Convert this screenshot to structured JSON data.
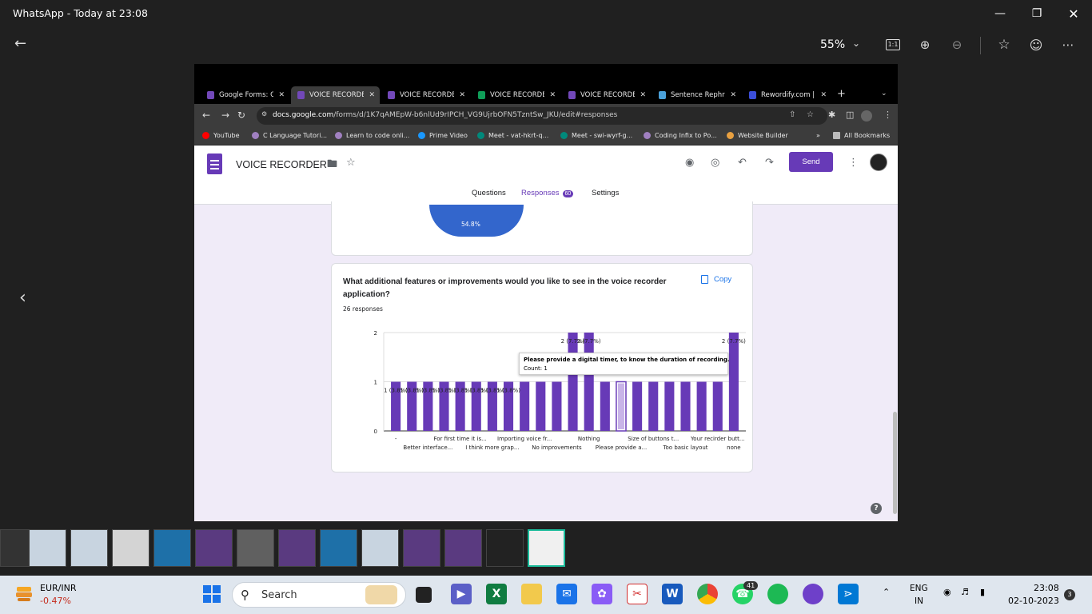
{
  "viewer": {
    "title": "WhatsApp - Today at 23:08",
    "zoom": "55%",
    "ratio_label": "1:1"
  },
  "browser": {
    "tabs": [
      {
        "label": "Google Forms: O",
        "icon_color": "#7248b9",
        "active": false
      },
      {
        "label": "VOICE RECORDE",
        "icon_color": "#7248b9",
        "active": true
      },
      {
        "label": "VOICE RECORDE",
        "icon_color": "#7248b9",
        "active": false
      },
      {
        "label": "VOICE RECORDE",
        "icon_color": "#0f9d58",
        "active": false
      },
      {
        "label": "VOICE RECORDE",
        "icon_color": "#7248b9",
        "active": false
      },
      {
        "label": "Sentence Rephra",
        "icon_color": "#4aa0d8",
        "active": false
      },
      {
        "label": "Rewordify.com |",
        "icon_color": "#3b4ed8",
        "active": false
      }
    ],
    "url_host": "docs.google.com",
    "url_path": "/forms/d/1K7qAMEpW-b6nlUd9rIPCH_VG9UjrbOFN5TzntSw_JKU/edit#responses",
    "bookmarks": [
      {
        "label": "YouTube",
        "icon_color": "#ff0000"
      },
      {
        "label": "C Language Tutori...",
        "icon_color": "#a080c0"
      },
      {
        "label": "Learn to code onli...",
        "icon_color": "#a080c0"
      },
      {
        "label": "Prime Video",
        "icon_color": "#1a98ff"
      },
      {
        "label": "Meet - vat-hkrt-q...",
        "icon_color": "#00897b"
      },
      {
        "label": "Meet - swi-wyrf-g...",
        "icon_color": "#00897b"
      },
      {
        "label": "Coding Infix to Po...",
        "icon_color": "#a080c0"
      },
      {
        "label": "Website Builder",
        "icon_color": "#e8a040"
      }
    ],
    "bookmarks_more": "»",
    "all_bookmarks": "All Bookmarks"
  },
  "form": {
    "title": "VOICE RECORDER",
    "send_label": "Send",
    "tabs": {
      "questions": "Questions",
      "responses": "Responses",
      "responses_count": "60",
      "settings": "Settings"
    },
    "pie_label": "54.8%",
    "question": {
      "title": "What additional features or improvements would you like to see in the voice recorder application?",
      "responses": "26 responses",
      "copy_label": "Copy"
    },
    "tooltip": {
      "title": "Please provide a digital timer, to know the duration of recording.",
      "count": "Count: 1"
    },
    "help": "?"
  },
  "chart_data": {
    "type": "bar",
    "values": [
      1,
      1,
      1,
      1,
      1,
      1,
      1,
      1,
      1,
      1,
      1,
      2,
      2,
      1,
      1,
      1,
      1,
      1,
      1,
      1,
      1,
      2
    ],
    "highlighted_index": 14,
    "ylim": [
      0,
      2
    ],
    "yticks": [
      "0",
      "1",
      "2"
    ],
    "color": "#673ab7",
    "bar_labels": [
      {
        "index": 0,
        "text": "1 (3.8%)"
      },
      {
        "index": 1,
        "text": "1 (3.8%)"
      },
      {
        "index": 2,
        "text": "1 (3.8%)"
      },
      {
        "index": 3,
        "text": "1 (3.8%)"
      },
      {
        "index": 4,
        "text": "1 (3.8%)"
      },
      {
        "index": 5,
        "text": "1 (3.8%)"
      },
      {
        "index": 6,
        "text": "1 (3.8%)"
      },
      {
        "index": 7,
        "text": "1 (3.8%)"
      },
      {
        "index": 11,
        "text": "2 (7.7%)"
      },
      {
        "index": 12,
        "text": "2 (7.7%)"
      },
      {
        "index": 21,
        "text": "2 (7.7%)"
      }
    ],
    "x_labels_upper": [
      {
        "index": 0,
        "text": "-"
      },
      {
        "index": 4,
        "text": "For first time it is..."
      },
      {
        "index": 8,
        "text": "Importing voice fr..."
      },
      {
        "index": 12,
        "text": "Nothing"
      },
      {
        "index": 16,
        "text": "Size of buttons t..."
      },
      {
        "index": 20,
        "text": "Your recirder butt..."
      }
    ],
    "x_labels_lower": [
      {
        "index": 2,
        "text": "Better interface..."
      },
      {
        "index": 6,
        "text": "I think more grap..."
      },
      {
        "index": 10,
        "text": "No improvements"
      },
      {
        "index": 14,
        "text": "Please provide a..."
      },
      {
        "index": 18,
        "text": "Too basic layout"
      },
      {
        "index": 22,
        "text": "none"
      }
    ]
  },
  "taskbar": {
    "fx_pair": "EUR/INR",
    "fx_change": "-0.47%",
    "search_placeholder": "Search",
    "whatsapp_badge": "41",
    "lang_top": "ENG",
    "lang_bottom": "IN",
    "time": "23:08",
    "date": "02-10-2023",
    "notifications": "3"
  }
}
